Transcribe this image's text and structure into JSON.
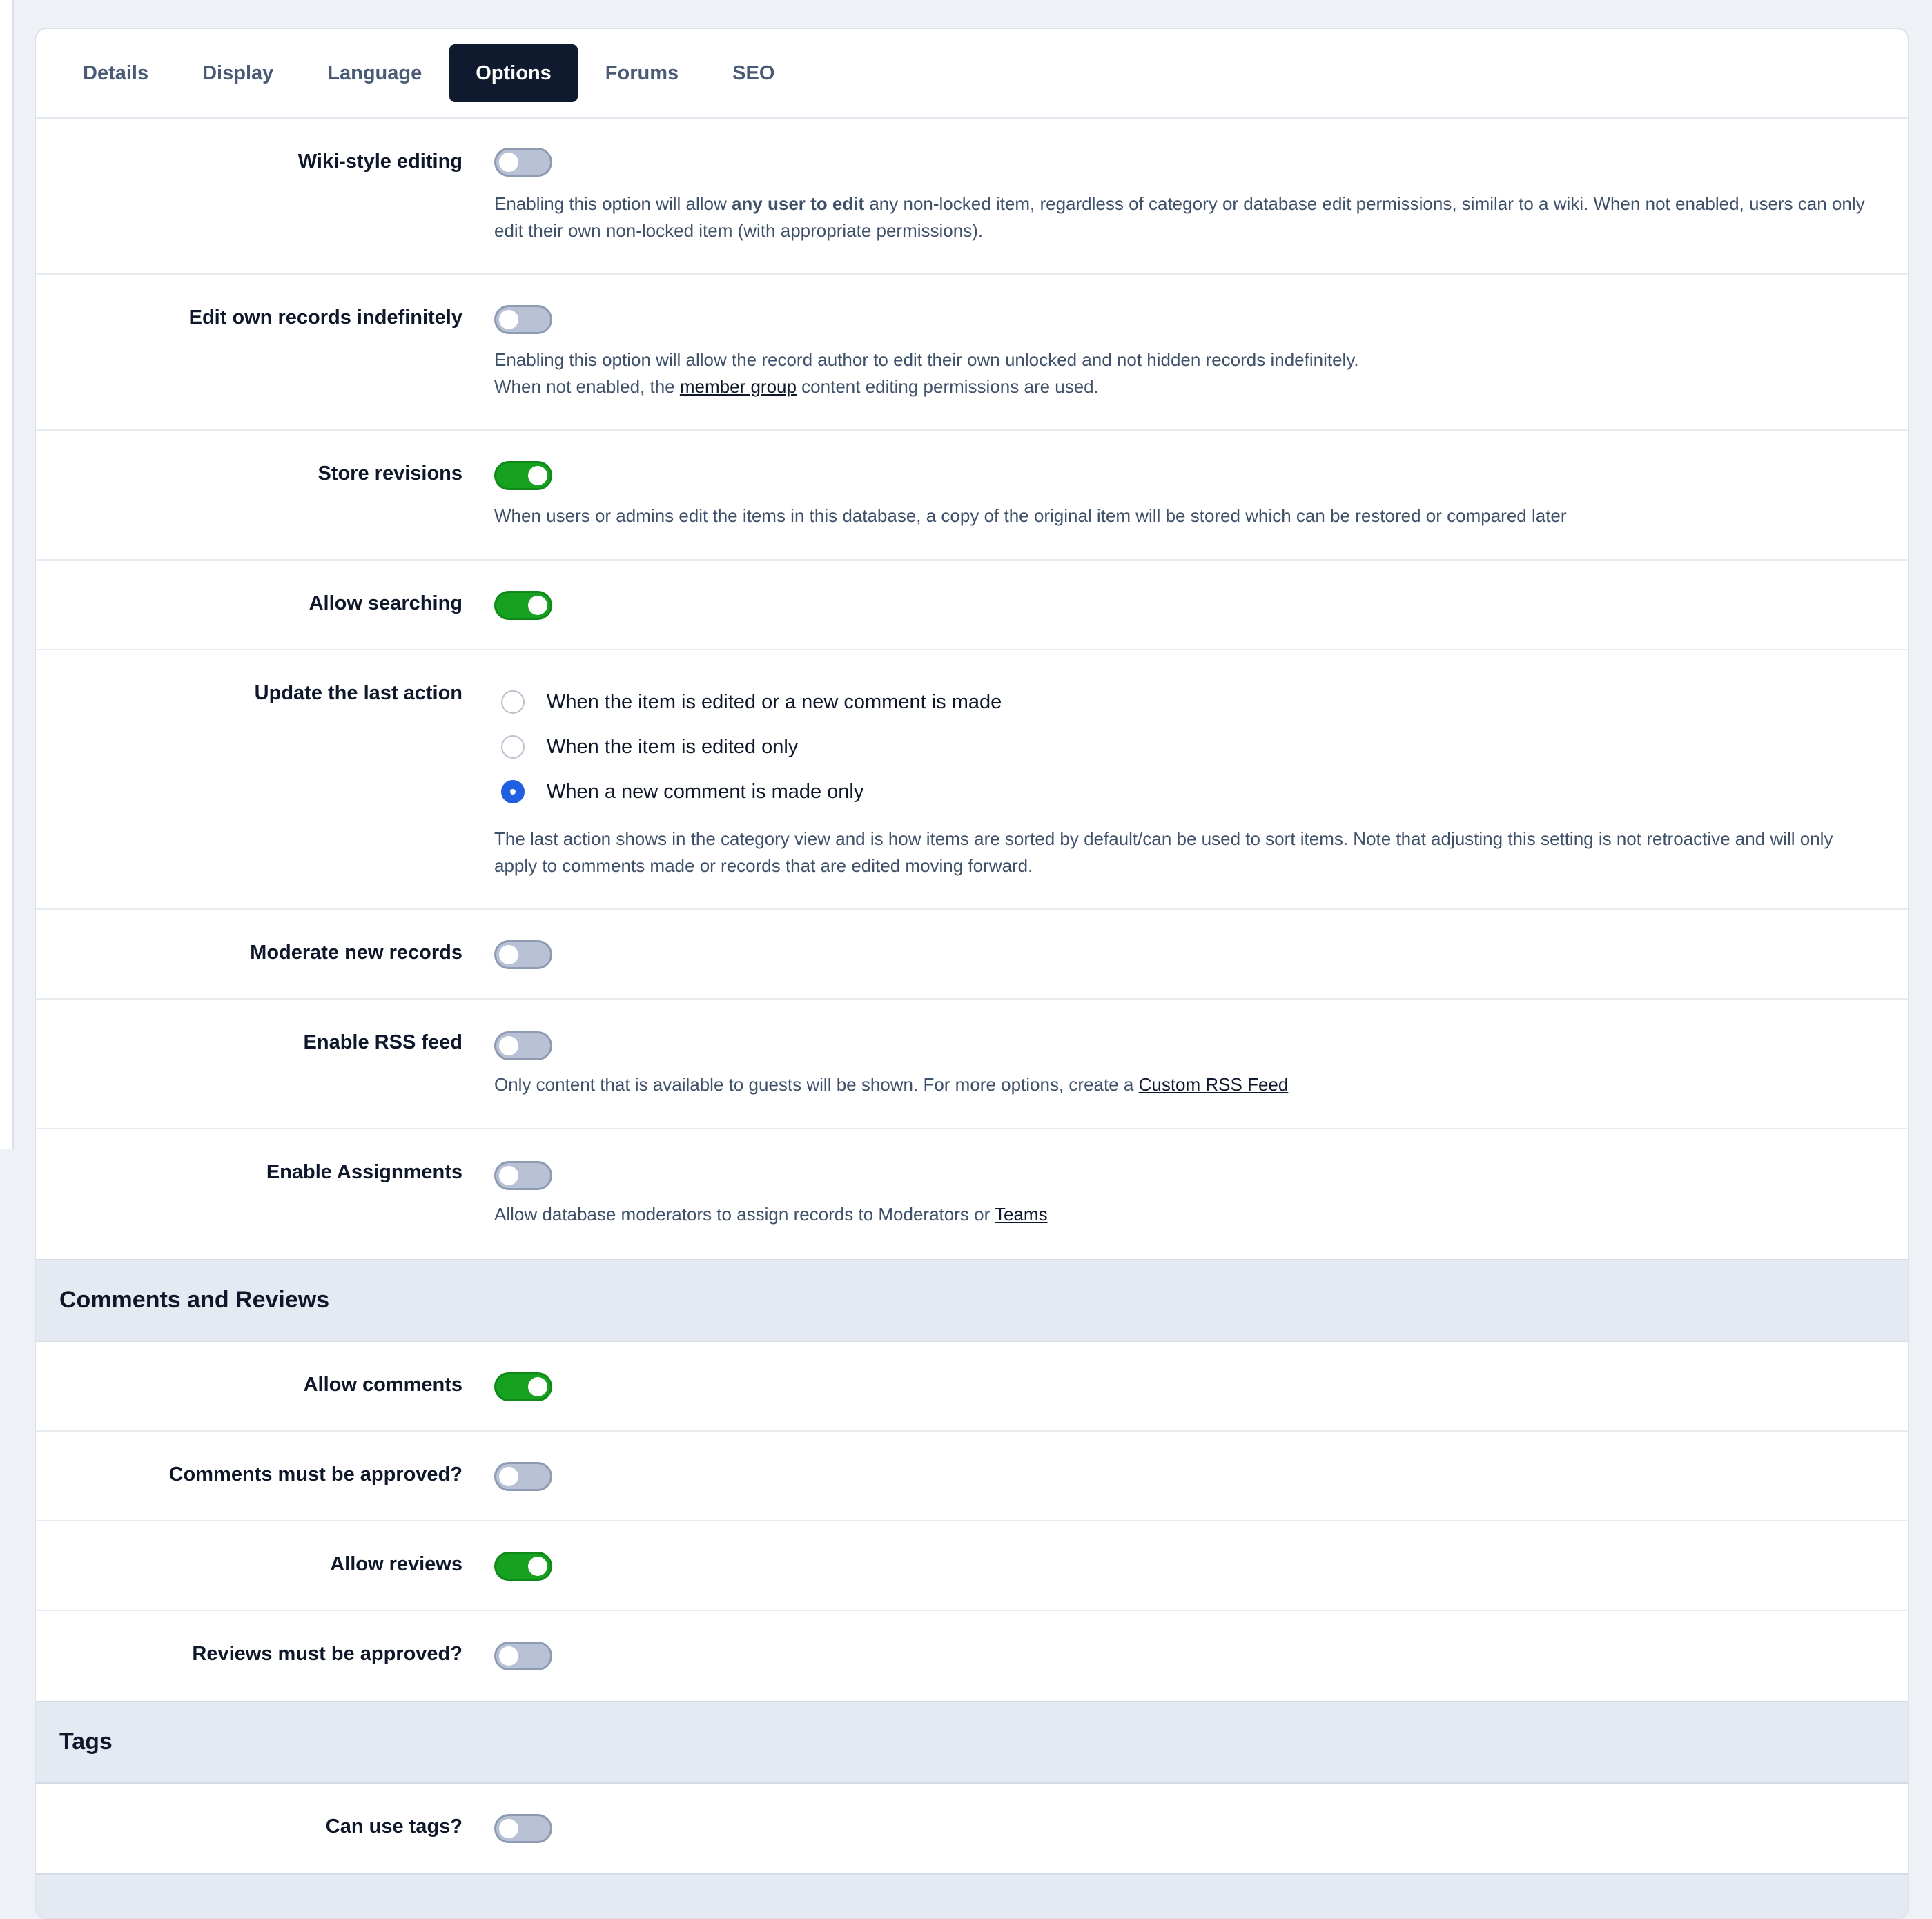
{
  "tabs": [
    "Details",
    "Display",
    "Language",
    "Options",
    "Forums",
    "SEO"
  ],
  "active_tab": "Options",
  "wiki": {
    "label": "Wiki-style editing",
    "desc_1": "Enabling this option will allow ",
    "desc_bold": "any user to edit",
    "desc_2": " any non-locked item, regardless of category or database edit permissions, similar to a wiki. When not enabled, users can only edit their own non-locked item (with appropriate permissions).",
    "on": false
  },
  "edit_own": {
    "label": "Edit own records indefinitely",
    "desc_line1": "Enabling this option will allow the record author to edit their own unlocked and not hidden records indefinitely.",
    "desc_2a": "When not enabled, the ",
    "desc_link": "member group",
    "desc_2b": " content editing permissions are used.",
    "on": false
  },
  "revisions": {
    "label": "Store revisions",
    "desc": "When users or admins edit the items in this database, a copy of the original item will be stored which can be restored or compared later",
    "on": true
  },
  "searching": {
    "label": "Allow searching",
    "on": true
  },
  "last_action": {
    "label": "Update the last action",
    "options": [
      "When the item is edited or a new comment is made",
      "When the item is edited only",
      "When a new comment is made only"
    ],
    "selected": 2,
    "desc": "The last action shows in the category view and is how items are sorted by default/can be used to sort items. Note that adjusting this setting is not retroactive and will only apply to comments made or records that are edited moving forward."
  },
  "moderate": {
    "label": "Moderate new records",
    "on": false
  },
  "rss": {
    "label": "Enable RSS feed",
    "desc_a": "Only content that is available to guests will be shown. For more options, create a ",
    "desc_link": "Custom RSS Feed",
    "on": false
  },
  "assignments": {
    "label": "Enable Assignments",
    "desc_a": "Allow database moderators to assign records to Moderators or ",
    "desc_link": "Teams",
    "on": false
  },
  "section_comments": "Comments and Reviews",
  "allow_comments": {
    "label": "Allow comments",
    "on": true
  },
  "comments_approved": {
    "label": "Comments must be approved?",
    "on": false
  },
  "allow_reviews": {
    "label": "Allow reviews",
    "on": true
  },
  "reviews_approved": {
    "label": "Reviews must be approved?",
    "on": false
  },
  "section_tags": "Tags",
  "can_use_tags": {
    "label": "Can use tags?",
    "on": false
  },
  "colors": {
    "toggle_on": "#16a121",
    "toggle_off": "#b8c2d4",
    "radio_checked": "#1f5fe0",
    "tab_active": "#0f1a2e"
  }
}
